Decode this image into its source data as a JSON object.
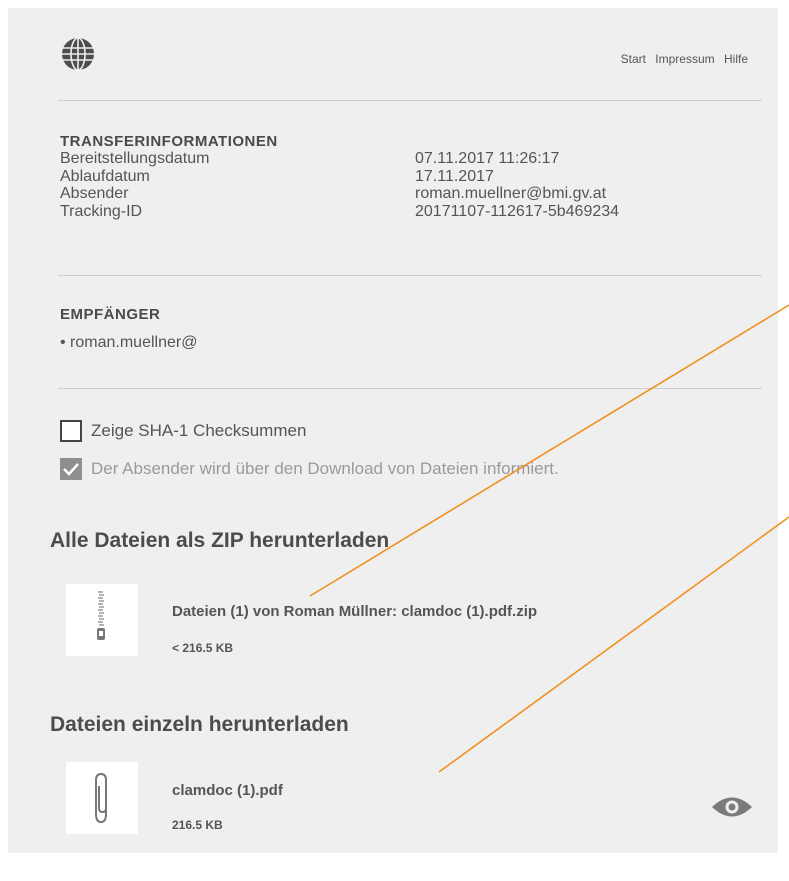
{
  "nav": {
    "start": "Start",
    "impressum": "Impressum",
    "hilfe": "Hilfe"
  },
  "transfer": {
    "title": "TRANSFERINFORMATIONEN",
    "rows": [
      {
        "label": "Bereitstellungsdatum",
        "value": "07.11.2017 11:26:17"
      },
      {
        "label": "Ablaufdatum",
        "value": "17.11.2017"
      },
      {
        "label": "Absender",
        "value": "roman.muellner@bmi.gv.at"
      },
      {
        "label": "Tracking-ID",
        "value": "20171107-112617-5b469234"
      }
    ]
  },
  "recipients": {
    "title": "EMPFÄNGER",
    "items": [
      "• roman.muellner@"
    ]
  },
  "options": {
    "sha1": {
      "label": "Zeige SHA-1 Checksummen",
      "checked": false
    },
    "notify": {
      "label": "Der Absender wird über den Download von Dateien informiert.",
      "checked": true
    }
  },
  "zip_section": {
    "title": "Alle Dateien als ZIP herunterladen",
    "file_name": "Dateien (1) von Roman Müllner: clamdoc (1).pdf.zip",
    "file_size": "< 216.5 KB"
  },
  "single_section": {
    "title": "Dateien einzeln herunterladen",
    "file_name": "clamdoc (1).pdf",
    "file_size": "216.5 KB"
  },
  "icons": [
    "globe-icon",
    "zip-icon",
    "paperclip-icon",
    "eye-icon",
    "checkmark-icon"
  ],
  "colors": {
    "annotation_line": "#f0901e",
    "panel_bg": "#efefef",
    "check_bg": "#8f8f8f"
  }
}
